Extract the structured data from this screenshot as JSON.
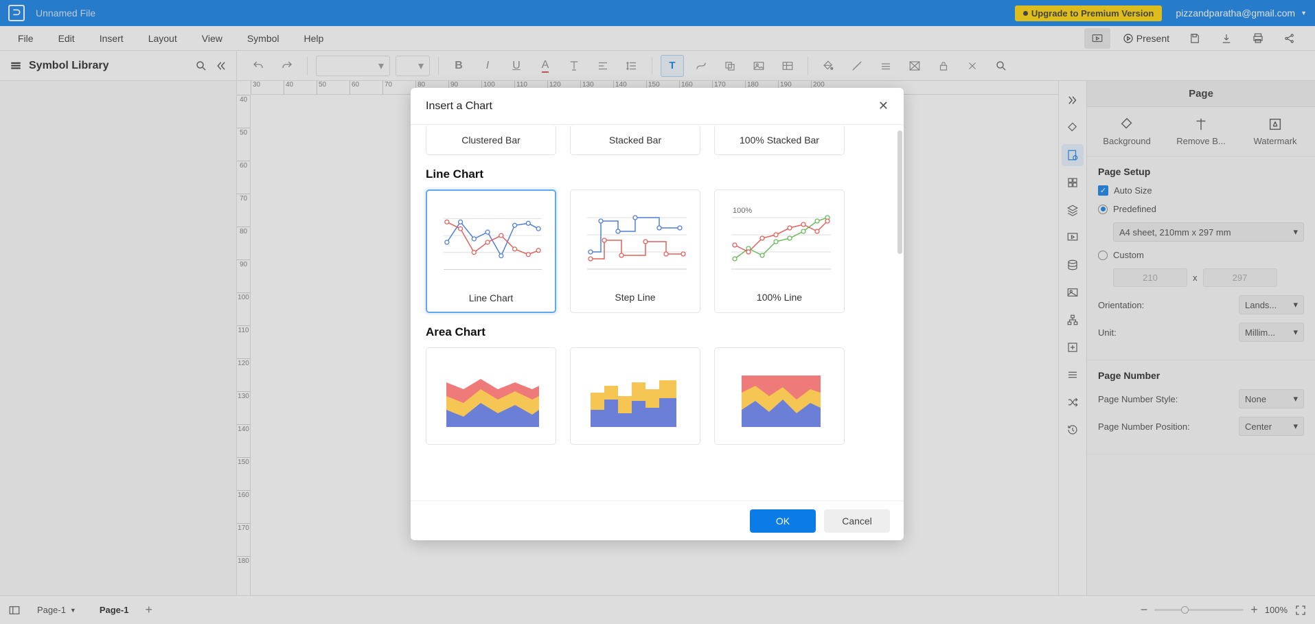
{
  "titlebar": {
    "filename": "Unnamed File",
    "upgrade_label": "Upgrade to Premium Version",
    "user_email": "pizzandparatha@gmail.com"
  },
  "menubar": {
    "items": [
      "File",
      "Edit",
      "Insert",
      "Layout",
      "View",
      "Symbol",
      "Help"
    ],
    "present_label": "Present"
  },
  "symbol_library": {
    "title": "Symbol Library"
  },
  "ruler_h": [
    "30",
    "40",
    "50",
    "60",
    "70",
    "80",
    "90",
    "100",
    "110",
    "120",
    "130",
    "140",
    "150",
    "160",
    "170",
    "180",
    "190",
    "200"
  ],
  "ruler_v": [
    "40",
    "50",
    "60",
    "70",
    "80",
    "90",
    "100",
    "110",
    "120",
    "130",
    "140",
    "150",
    "160",
    "170",
    "180"
  ],
  "right_panel": {
    "title": "Page",
    "buttons": {
      "background": "Background",
      "remove_bg": "Remove B...",
      "watermark": "Watermark"
    },
    "page_setup": {
      "title": "Page Setup",
      "auto_size": "Auto Size",
      "predefined": "Predefined",
      "sheet": "A4 sheet, 210mm x 297 mm",
      "custom": "Custom",
      "w": "210",
      "h": "297",
      "x": "x",
      "orientation_label": "Orientation:",
      "orientation_value": "Lands...",
      "unit_label": "Unit:",
      "unit_value": "Millim..."
    },
    "page_number": {
      "title": "Page Number",
      "style_label": "Page Number Style:",
      "style_value": "None",
      "position_label": "Page Number Position:",
      "position_value": "Center"
    }
  },
  "statusbar": {
    "page_dropdown": "Page-1",
    "page_tab": "Page-1",
    "zoom": "100%"
  },
  "dialog": {
    "title": "Insert a Chart",
    "bar_labels": {
      "clustered": "Clustered Bar",
      "stacked": "Stacked Bar",
      "stacked100": "100% Stacked Bar"
    },
    "line_title": "Line Chart",
    "line_labels": {
      "line": "Line Chart",
      "step": "Step Line",
      "line100": "100% Line"
    },
    "line100_badge": "100%",
    "area_title": "Area Chart",
    "ok": "OK",
    "cancel": "Cancel"
  }
}
